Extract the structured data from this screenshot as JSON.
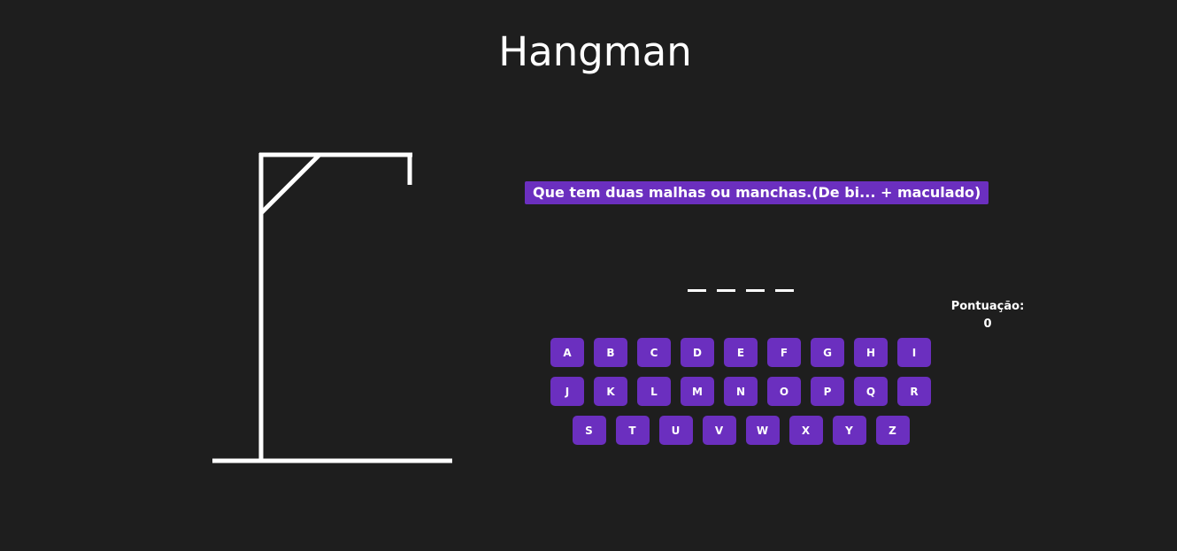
{
  "app": {
    "title": "Hangman"
  },
  "game": {
    "hint": "Que tem duas malhas ou manchas.(De bi... + maculado)",
    "word_slots": [
      "",
      "",
      "",
      ""
    ],
    "score_label": "Pontuação:",
    "score_value": "0",
    "keyboard_rows": [
      [
        "A",
        "B",
        "C",
        "D",
        "E",
        "F",
        "G",
        "H",
        "I"
      ],
      [
        "J",
        "K",
        "L",
        "M",
        "N",
        "O",
        "P",
        "Q",
        "R"
      ],
      [
        "S",
        "T",
        "U",
        "V",
        "W",
        "X",
        "Y",
        "Z"
      ]
    ]
  },
  "colors": {
    "background": "#1e1e1e",
    "accent": "#6b2fbf",
    "text": "#ffffff"
  }
}
